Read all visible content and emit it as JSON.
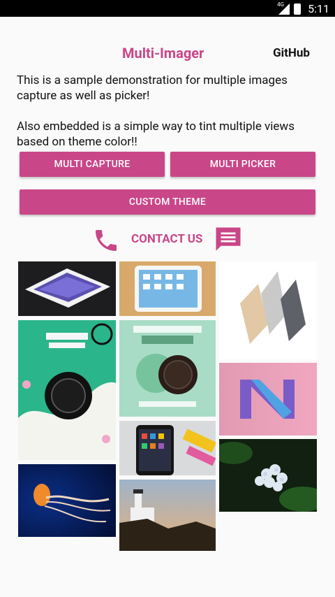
{
  "status_bar": {
    "network_label": "4G",
    "time": "5:11"
  },
  "header": {
    "title": "Multi-Imager",
    "github_link": "GitHub"
  },
  "description": {
    "line1": "This is a sample demonstration for multiple images capture as well as picker!",
    "line2": "Also embedded is a simple way to tint multiple views based on theme color!!"
  },
  "buttons": {
    "multi_capture": "MULTI CAPTURE",
    "multi_picker": "MULTI PICKER",
    "custom_theme": "CUSTOM THEME"
  },
  "contact": {
    "label": "CONTACT US"
  },
  "theme": {
    "accent": "#c94688"
  },
  "gallery": {
    "image_count": 11
  }
}
